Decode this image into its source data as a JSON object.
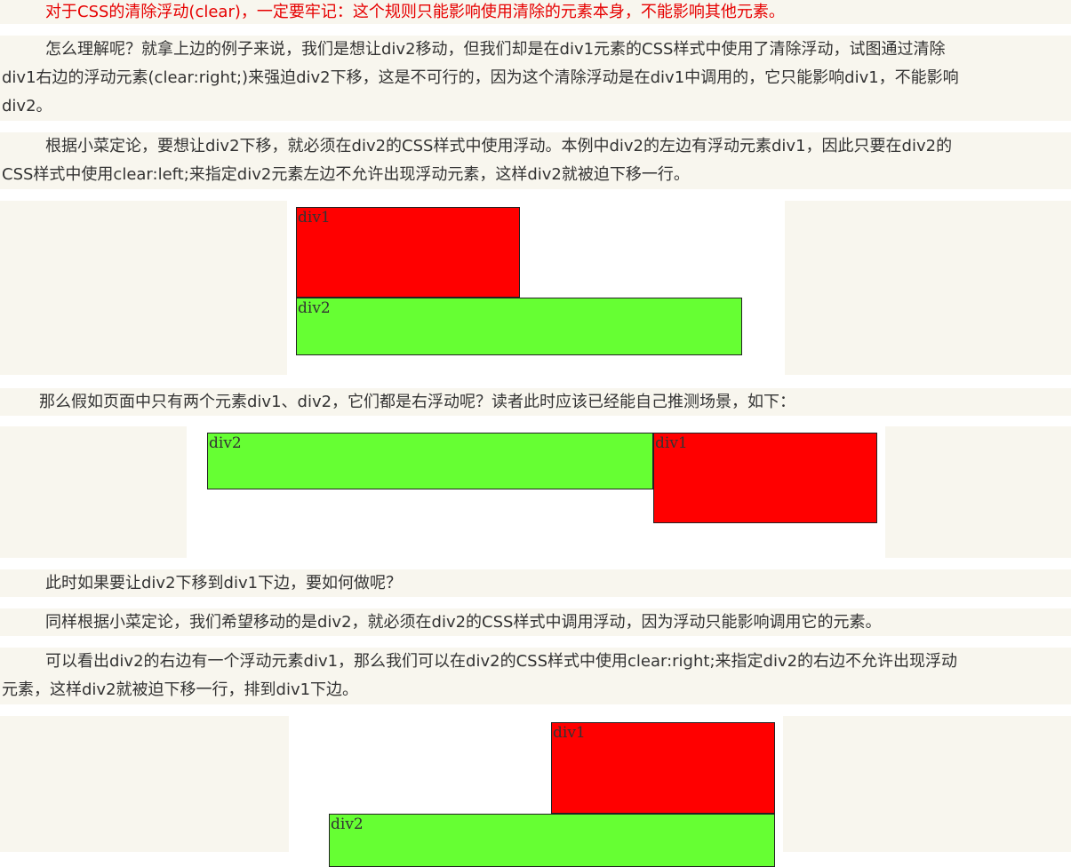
{
  "paragraphs": {
    "p1": "对于CSS的清除浮动(clear)，一定要牢记：这个规则只能影响使用清除的元素本身，不能影响其他元素。",
    "p2_l1": "怎么理解呢？就拿上边的例子来说，我们是想让div2移动，但我们却是在div1元素的CSS样式中使用了清除浮动，试图通过清除",
    "p2_l2": "div1右边的浮动元素(clear:right;)来强迫div2下移，这是不可行的，因为这个清除浮动是在div1中调用的，它只能影响div1，不能影响",
    "p2_l3": "div2。",
    "p3_l1": "根据小菜定论，要想让div2下移，就必须在div2的CSS样式中使用浮动。本例中div2的左边有浮动元素div1，因此只要在div2的",
    "p3_l2": "CSS样式中使用clear:left;来指定div2元素左边不允许出现浮动元素，这样div2就被迫下移一行。",
    "p4": "那么假如页面中只有两个元素div1、div2，它们都是右浮动呢？读者此时应该已经能自己推测场景，如下：",
    "p5": "此时如果要让div2下移到div1下边，要如何做呢？",
    "p6": "同样根据小菜定论，我们希望移动的是div2，就必须在div2的CSS样式中调用浮动，因为浮动只能影响调用它的元素。",
    "p7_l1": "可以看出div2的右边有一个浮动元素div1，那么我们可以在div2的CSS样式中使用clear:right;来指定div2的右边不允许出现浮动",
    "p7_l2": "元素，这样div2就被迫下移一行，排到div1下边。"
  },
  "demos": {
    "demo1": {
      "div1_label": "div1",
      "div2_label": "div2"
    },
    "demo2": {
      "div1_label": "div1",
      "div2_label": "div2"
    },
    "demo3": {
      "div1_label": "div1",
      "div2_label": "div2"
    }
  },
  "colors": {
    "paragraph_bg": "#f8f6ee",
    "div1_fill": "#ff0000",
    "div2_fill": "#66ff33",
    "highlight_text": "#e60000"
  }
}
